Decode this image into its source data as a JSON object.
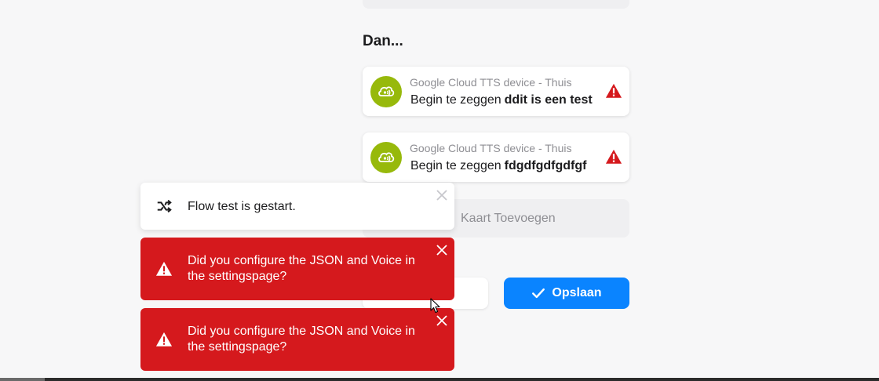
{
  "section": {
    "title": "Dan..."
  },
  "actions": [
    {
      "device": "Google Cloud TTS device - Thuis",
      "action": "Begin te zeggen",
      "value": "ddit is een test"
    },
    {
      "device": "Google Cloud TTS device - Thuis",
      "action": "Begin te zeggen",
      "value": "fdgdfgdfgdfgf"
    }
  ],
  "add_card": {
    "label": "Kaart Toevoegen"
  },
  "buttons": {
    "save_label": "Opslaan"
  },
  "toasts": [
    {
      "type": "info",
      "text": "Flow test is gestart."
    },
    {
      "type": "error",
      "text": "Did you configure the JSON and Voice in the settingspage?"
    },
    {
      "type": "error",
      "text": "Did you configure the JSON and Voice in the settingspage?"
    }
  ],
  "colors": {
    "device_green": "#97b90b",
    "primary_blue": "#0a84ff",
    "error_red": "#d5191d",
    "warning_red": "#d5191d"
  }
}
